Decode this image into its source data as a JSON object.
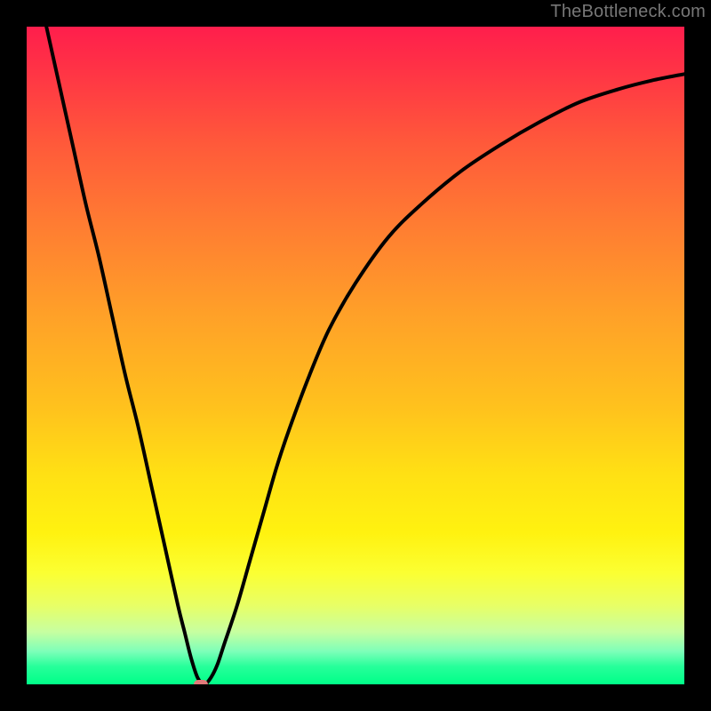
{
  "attribution": "TheBottleneck.com",
  "colors": {
    "frame": "#000000",
    "curve_stroke": "#000000",
    "marker": "#e07a7a",
    "gradient_top": "#ff1e4c",
    "gradient_bottom": "#00ff88"
  },
  "chart_data": {
    "type": "line",
    "title": "",
    "xlabel": "",
    "ylabel": "",
    "xlim": [
      0,
      100
    ],
    "ylim": [
      0,
      100
    ],
    "x": [
      3,
      5,
      7,
      9,
      11,
      13,
      15,
      17,
      19,
      21,
      23,
      24,
      25,
      26,
      27,
      28,
      29,
      30,
      32,
      34,
      36,
      38,
      40,
      43,
      46,
      50,
      55,
      60,
      66,
      72,
      78,
      84,
      90,
      95,
      100
    ],
    "values": [
      100,
      91,
      82,
      73,
      65,
      56,
      47,
      39,
      30,
      21,
      12,
      8,
      4,
      1,
      0,
      1,
      3,
      6,
      12,
      19,
      26,
      33,
      39,
      47,
      54,
      61,
      68,
      73,
      78,
      82,
      85.5,
      88.5,
      90.5,
      91.8,
      92.8
    ],
    "marker": {
      "x": 26.5,
      "y": 0
    }
  }
}
